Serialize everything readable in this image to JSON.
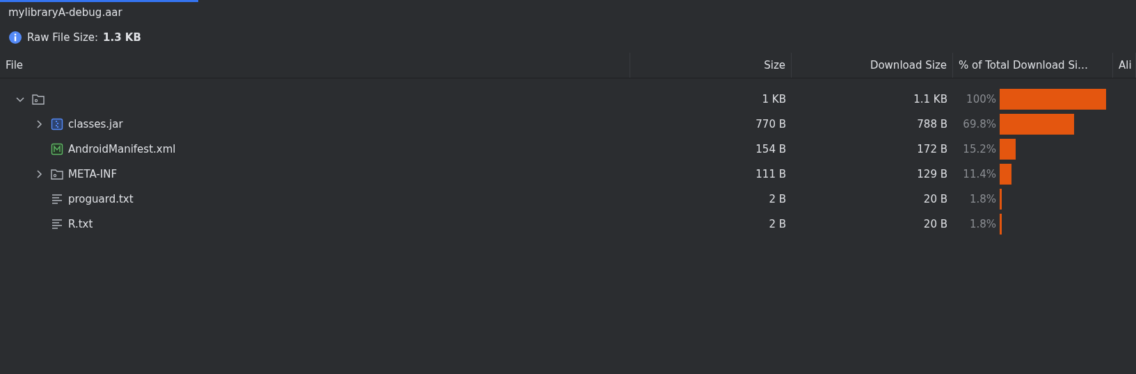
{
  "tab": {
    "title": "mylibraryA-debug.aar",
    "selected": true
  },
  "raw_size": {
    "label": "Raw File Size:",
    "value": "1.3 KB"
  },
  "table": {
    "columns": [
      "File",
      "Size",
      "Download Size",
      "% of Total Download Si…",
      "Ali"
    ],
    "rows": [
      {
        "kind": "folder",
        "expanded": true,
        "size": "1 KB",
        "download_size": "1.1 KB",
        "percent": "100%",
        "children": [
          {
            "kind": "jar",
            "name": "classes.jar",
            "expanded": false,
            "size": "770 B",
            "download_size": "788 B",
            "percent": "69.8%"
          },
          {
            "kind": "manifest",
            "name": "AndroidManifest.xml",
            "size": "154 B",
            "download_size": "172 B",
            "percent": "15.2%"
          },
          {
            "kind": "folder",
            "name": "META-INF",
            "expanded": false,
            "size": "111 B",
            "download_size": "129 B",
            "percent": "11.4%"
          },
          {
            "kind": "text",
            "name": "proguard.txt",
            "size": "2 B",
            "download_size": "20 B",
            "percent": "1.8%"
          },
          {
            "kind": "text",
            "name": "R.txt",
            "size": "2 B",
            "download_size": "20 B",
            "percent": "1.8%"
          }
        ]
      }
    ]
  }
}
